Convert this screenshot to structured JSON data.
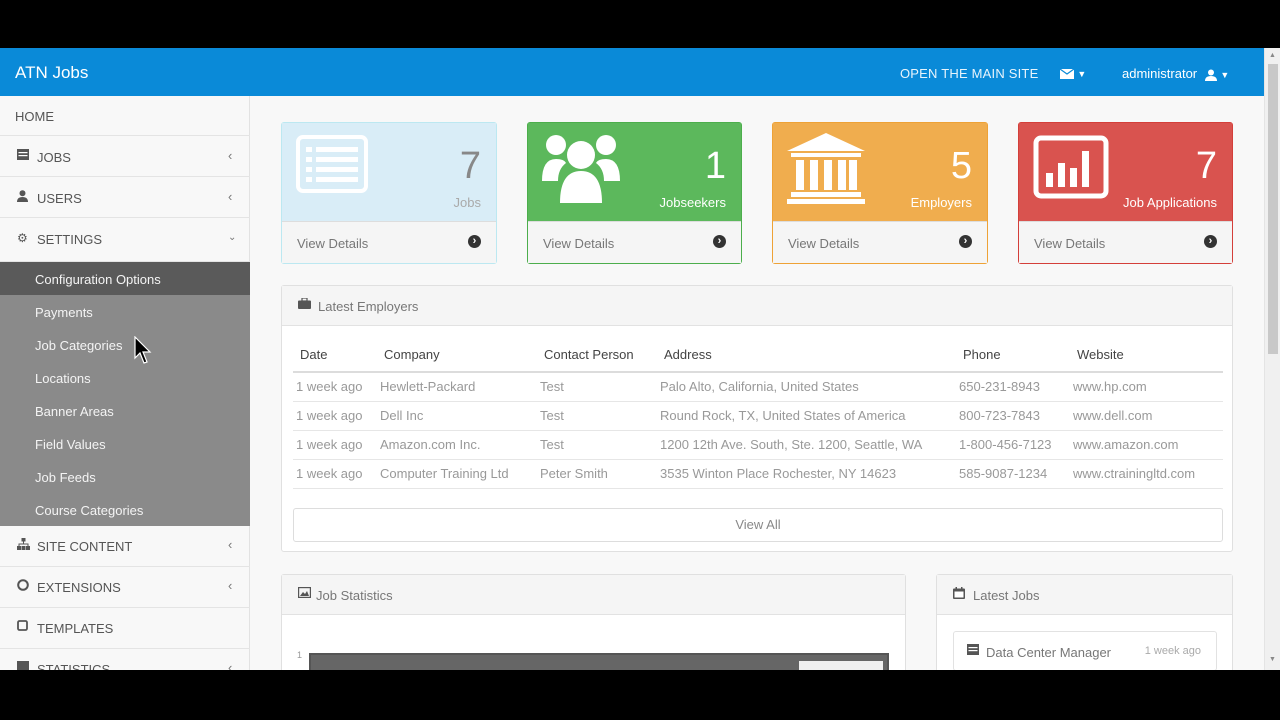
{
  "topbar": {
    "brand": "ATN Jobs",
    "open_site": "OPEN THE MAIN SITE",
    "user": "administrator"
  },
  "sidebar": {
    "home": "HOME",
    "jobs": "JOBS",
    "users": "USERS",
    "settings": "SETTINGS",
    "settings_submenu": [
      "Configuration Options",
      "Payments",
      "Job Categories",
      "Locations",
      "Banner Areas",
      "Field Values",
      "Job Feeds",
      "Course Categories"
    ],
    "site_content": "SITE CONTENT",
    "extensions": "EXTENSIONS",
    "templates": "TEMPLATES",
    "statistics": "STATISTICS"
  },
  "stats": [
    {
      "value": "7",
      "label": "Jobs",
      "footer": "View Details",
      "color": "#d9edf7"
    },
    {
      "value": "1",
      "label": "Jobseekers",
      "footer": "View Details",
      "color": "#5cb85c"
    },
    {
      "value": "5",
      "label": "Employers",
      "footer": "View Details",
      "color": "#f0ad4e"
    },
    {
      "value": "7",
      "label": "Job Applications",
      "footer": "View Details",
      "color": "#d9534f"
    }
  ],
  "latest_employers": {
    "title": "Latest Employers",
    "columns": [
      "Date",
      "Company",
      "Contact Person",
      "Address",
      "Phone",
      "Website"
    ],
    "rows": [
      [
        "1 week ago",
        "Hewlett-Packard",
        "Test",
        "Palo Alto, California, United States",
        "650-231-8943",
        "www.hp.com"
      ],
      [
        "1 week ago",
        "Dell Inc",
        "Test",
        "Round Rock, TX, United States of America",
        "800-723-7843",
        "www.dell.com"
      ],
      [
        "1 week ago",
        "Amazon.com Inc.",
        "Test",
        "1200 12th Ave. South, Ste. 1200, Seattle, WA",
        "1-800-456-7123",
        "www.amazon.com"
      ],
      [
        "1 week ago",
        "Computer Training Ltd",
        "Peter Smith",
        "3535 Winton Place Rochester, NY 14623",
        "585-9087-1234",
        "www.ctrainingltd.com"
      ]
    ],
    "view_all": "View All"
  },
  "job_statistics": {
    "title": "Job Statistics",
    "tick": "1"
  },
  "latest_jobs": {
    "title": "Latest Jobs",
    "items": [
      {
        "title": "Data Center Manager",
        "time": "1 week ago"
      }
    ]
  }
}
